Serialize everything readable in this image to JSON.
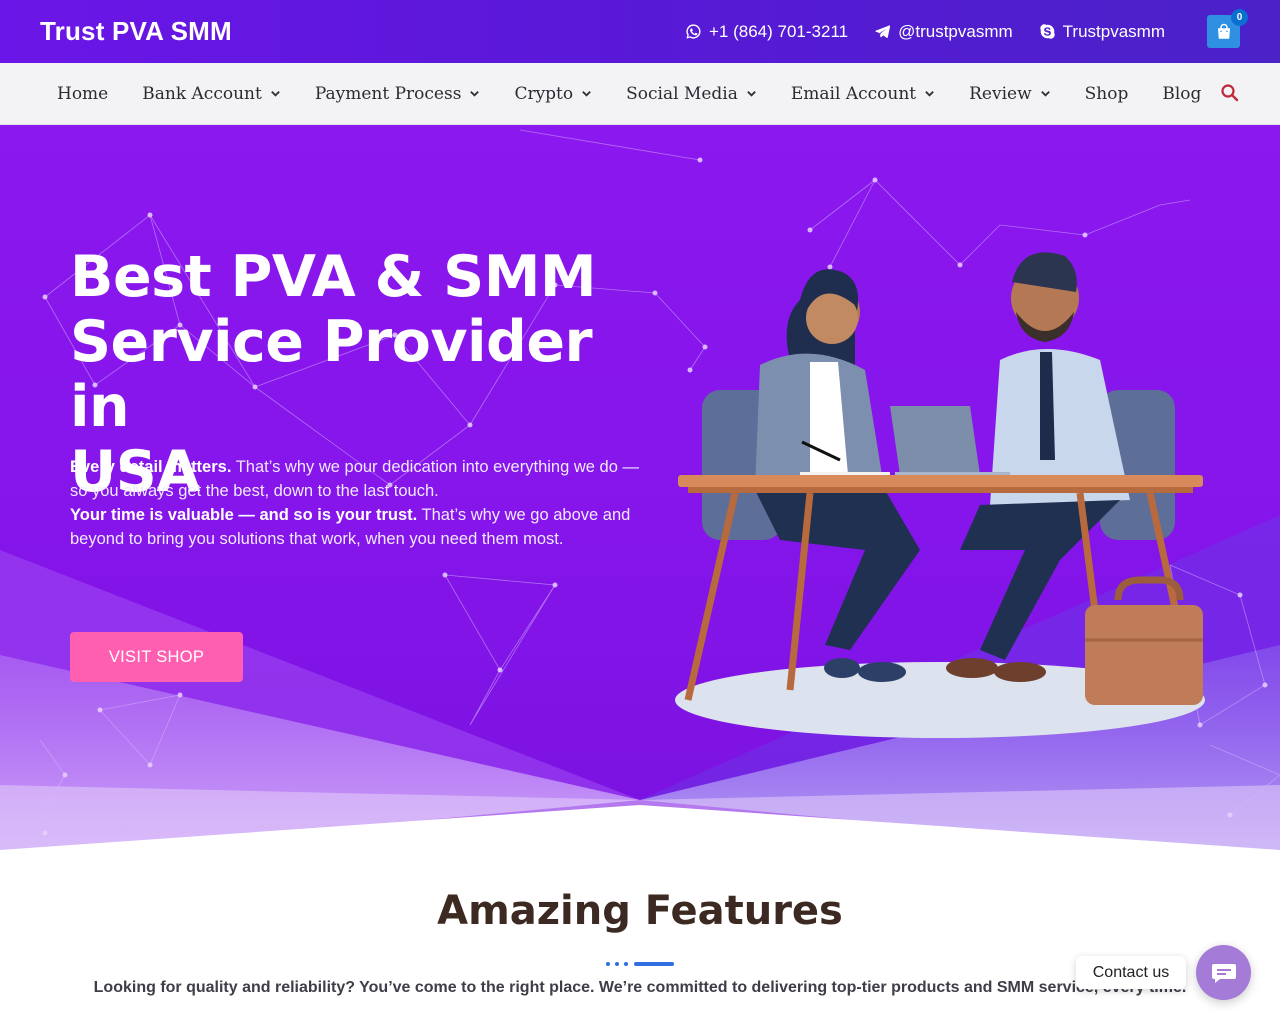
{
  "header": {
    "brand": "Trust PVA SMM",
    "phone": "+1 (864) 701-3211",
    "telegram": "@trustpvasmm",
    "skype": "Trustpvasmm",
    "cart_count": "0",
    "icons": [
      "whatsapp-icon",
      "telegram-icon",
      "skype-icon",
      "cart-icon"
    ]
  },
  "nav": {
    "items": [
      {
        "label": "Home",
        "dropdown": false
      },
      {
        "label": "Bank Account",
        "dropdown": true
      },
      {
        "label": "Payment Process",
        "dropdown": true
      },
      {
        "label": "Crypto",
        "dropdown": true
      },
      {
        "label": "Social Media",
        "dropdown": true
      },
      {
        "label": "Email Account",
        "dropdown": true
      },
      {
        "label": "Review",
        "dropdown": true
      },
      {
        "label": "Shop",
        "dropdown": false
      },
      {
        "label": "Blog",
        "dropdown": false
      }
    ],
    "search_icon": "search-icon"
  },
  "hero": {
    "title_line1": "Best PVA & SMM",
    "title_line2": "Service Provider in",
    "title_line3": "USA",
    "p1_bold": "Every detail matters.",
    "p1_text": " That’s why we pour dedication into everything we do — so you always get the best, down to the last touch.",
    "p2_bold": "Your time is valuable — and so is your trust.",
    "p2_text": " That’s why we go above and beyond to bring you solutions that work, when you need them most.",
    "button": "VISIT SHOP"
  },
  "features": {
    "title": "Amazing Features",
    "text": "Looking for quality and reliability? You’ve come to the right place. We’re committed to delivering top-tier products and SMM service, every time."
  },
  "chat": {
    "label": "Contact us",
    "icon": "chat-icon"
  },
  "colors": {
    "topbar": "#6b16e8",
    "hero": "#8b18ee",
    "button": "#ff5fb0",
    "cart": "#2f8fe0",
    "divider": "#2f6fe0"
  }
}
